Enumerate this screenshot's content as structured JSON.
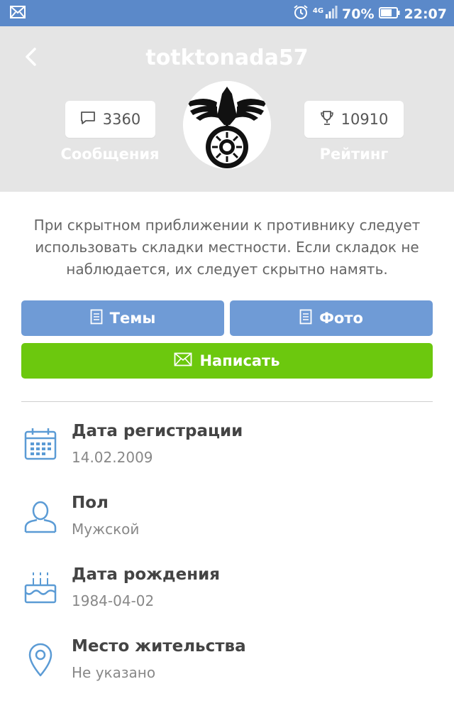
{
  "statusbar": {
    "network": "4G",
    "battery": "70%",
    "time": "22:07"
  },
  "profile": {
    "username": "totktonada57",
    "messages_count": "3360",
    "messages_label": "Сообщения",
    "rating_count": "10910",
    "rating_label": "Рейтинг",
    "status": "При скрытном приближении к противнику следует использовать складки местности. Если складок не наблюдается, их следует скрытно намять."
  },
  "actions": {
    "topics_label": "Темы",
    "photo_label": "Фото",
    "write_label": "Написать"
  },
  "info": [
    {
      "title": "Дата регистрации",
      "value": "14.02.2009",
      "icon": "calendar-icon"
    },
    {
      "title": "Пол",
      "value": "Мужской",
      "icon": "user-icon"
    },
    {
      "title": "Дата рождения",
      "value": "1984-04-02",
      "icon": "birthday-cake-icon"
    },
    {
      "title": "Место жительства",
      "value": "Не указано",
      "icon": "location-pin-icon"
    }
  ],
  "colors": {
    "statusbar": "#5b89c9",
    "header": "#e5e5e5",
    "blue_button": "#6f9bd6",
    "green_button": "#6cc80e",
    "icon_blue": "#5b9bd5"
  }
}
